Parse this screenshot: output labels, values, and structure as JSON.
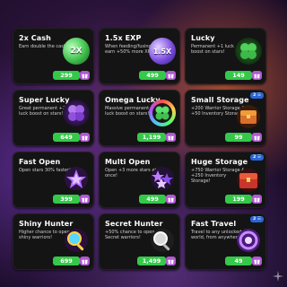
{
  "cards": [
    {
      "title": "2x Cash",
      "desc": "Earn double the cash!",
      "price": "299",
      "icon": "cash-multiplier-icon",
      "icon_text": "2X",
      "badge": ""
    },
    {
      "title": "1.5x EXP",
      "desc": "When feeding/fusing, earn +50% more XP!",
      "price": "499",
      "icon": "exp-multiplier-icon",
      "icon_text": "1.5X",
      "badge": ""
    },
    {
      "title": "Lucky",
      "desc": "Permanent +1 luck boost on stars!",
      "price": "149",
      "icon": "clover-icon",
      "icon_text": "",
      "badge": ""
    },
    {
      "title": "Super Lucky",
      "desc": "Great permanent +2 luck boost on stars!",
      "price": "649",
      "icon": "purple-clover-icon",
      "icon_text": "",
      "badge": ""
    },
    {
      "title": "Omega Lucky",
      "desc": "Massive permanent +3 luck boost on stars!",
      "price": "1,199",
      "icon": "omega-clover-icon",
      "icon_text": "",
      "badge": ""
    },
    {
      "title": "Small Storage",
      "desc": "+200 Warrior Storage & +50 Inventory Storage!",
      "price": "99",
      "icon": "storage-chest-icon",
      "icon_text": "",
      "badge": "2 ☰"
    },
    {
      "title": "Fast Open",
      "desc": "Open stars 30% faster!",
      "price": "399",
      "icon": "fast-open-icon",
      "icon_text": "",
      "badge": ""
    },
    {
      "title": "Multi Open",
      "desc": "Open +3 more stars at once!",
      "price": "499",
      "icon": "multi-open-icon",
      "icon_text": "",
      "badge": ""
    },
    {
      "title": "Huge Storage",
      "desc": "+750 Warrior Storage & +250 Inventory Storage!",
      "price": "199",
      "icon": "huge-storage-icon",
      "icon_text": "",
      "badge": "2 ☰"
    },
    {
      "title": "Shiny Hunter",
      "desc": "Higher chance to open shiny warriors!",
      "price": "699",
      "icon": "magnifier-icon",
      "icon_text": "",
      "badge": ""
    },
    {
      "title": "Secret Hunter",
      "desc": "+50% chance to open Secret warriors!",
      "price": "1,499",
      "icon": "secret-magnifier-icon",
      "icon_text": "",
      "badge": ""
    },
    {
      "title": "Fast Travel",
      "desc": "Travel to any unlocked world, from anywhere!",
      "price": "49",
      "icon": "portal-icon",
      "icon_text": "",
      "badge": "2 ☰"
    }
  ],
  "colors": {
    "card_bg": "#141414",
    "price_green": "#35c94a",
    "gift_purple": "#b05ad0",
    "badge_blue": "#2a66d8"
  }
}
